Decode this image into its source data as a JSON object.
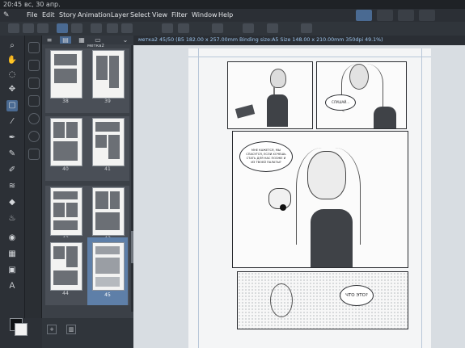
{
  "status_bar": {
    "time": "20:45",
    "date": "вс, 30 апр."
  },
  "menu": {
    "items": [
      "File",
      "Edit",
      "Story",
      "Animation",
      "Layer",
      "Select",
      "View",
      "Filter",
      "Window",
      "Help"
    ]
  },
  "document_tab": {
    "label": "метка2 45/50 (B5 182.00 x 257.00mm Binding size:A5 Size 148.00 x 210.00mm 350dpi 49.1%)"
  },
  "page_panel": {
    "top_partial": "метка2",
    "pages": [
      {
        "number": "38"
      },
      {
        "number": "39"
      },
      {
        "number": "40"
      },
      {
        "number": "41"
      },
      {
        "number": "42"
      },
      {
        "number": "43"
      },
      {
        "number": "44"
      },
      {
        "number": "45"
      }
    ],
    "selected_page": "45"
  },
  "comic": {
    "bubble_top": "СЛУШАЙ...",
    "bubble_main": "МНЕ КАЖЕТСЯ, МЫ СПАСУТСЯ, ЕСЛИ ХОЧЕШЬ СТАТЬ ДЛЯ НАС ПОЗЖЕ И ИЗ ТВОЕЙ ПАЛАТЫ?",
    "bubble_bottom": "ЧТО ЭТО?"
  },
  "icons": [
    "app-menu-icon",
    "zoom-icon",
    "move-icon",
    "pen-icon",
    "brush-icon",
    "eraser-icon",
    "fill-icon",
    "text-icon",
    "hand-icon"
  ],
  "colors": {
    "accent": "#4a6a92",
    "tab_text": "#9fc7ee",
    "selected_page": "#5e7fa8"
  }
}
